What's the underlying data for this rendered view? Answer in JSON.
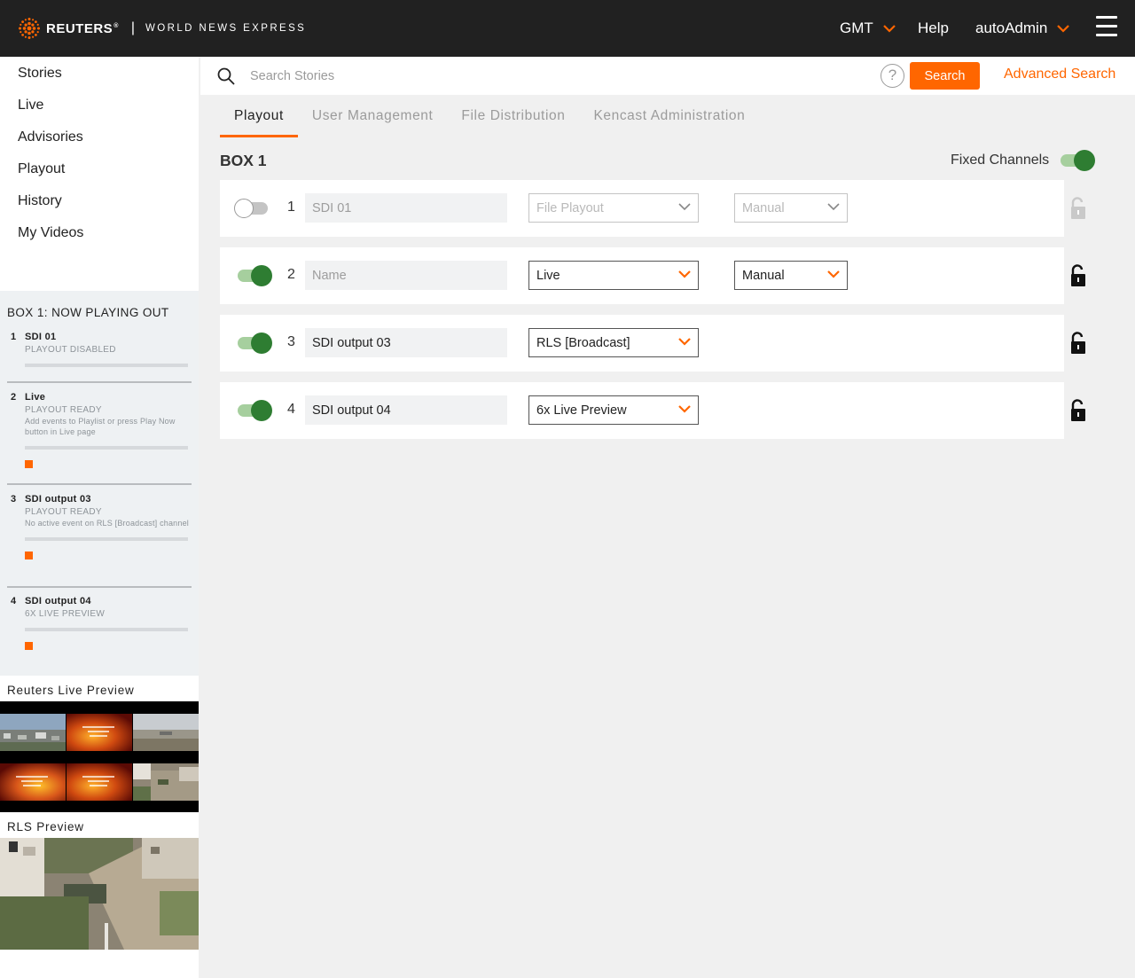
{
  "header": {
    "brand": "REUTERS",
    "brand_mark": "®",
    "separator": "|",
    "tagline": "WORLD NEWS EXPRESS",
    "timezone": "GMT",
    "help": "Help",
    "user": "autoAdmin",
    "accent_color": "#ff6600"
  },
  "nav": {
    "items": [
      {
        "label": "Stories"
      },
      {
        "label": "Live"
      },
      {
        "label": "Advisories"
      },
      {
        "label": "Playout"
      },
      {
        "label": "History"
      },
      {
        "label": "My Videos"
      }
    ]
  },
  "now_playing": {
    "title": "BOX 1: NOW PLAYING OUT",
    "channels": [
      {
        "num": "1",
        "name": "SDI 01",
        "status": "PLAYOUT DISABLED",
        "message": ""
      },
      {
        "num": "2",
        "name": "Live",
        "status": "PLAYOUT READY",
        "message": "Add events to Playlist or press Play Now button in Live page"
      },
      {
        "num": "3",
        "name": "SDI output 03",
        "status": "PLAYOUT READY",
        "message": "No active event on RLS [Broadcast] channel"
      },
      {
        "num": "4",
        "name": "SDI output 04",
        "status": "6X LIVE PREVIEW",
        "message": ""
      }
    ]
  },
  "previews": {
    "live_title": "Reuters Live Preview",
    "rls_title": "RLS Preview"
  },
  "search": {
    "placeholder": "Search Stories",
    "help_glyph": "?",
    "button": "Search",
    "advanced": "Advanced Search"
  },
  "tabs": [
    {
      "label": "Playout",
      "active": true
    },
    {
      "label": "User Management",
      "active": false
    },
    {
      "label": "File Distribution",
      "active": false
    },
    {
      "label": "Kencast Administration",
      "active": false
    }
  ],
  "box": {
    "title": "BOX 1",
    "fixed_channels_label": "Fixed Channels",
    "fixed_channels_on": true,
    "channels": [
      {
        "num": "1",
        "enabled": false,
        "name_value": "",
        "name_placeholder": "SDI 01",
        "source": "File Playout",
        "mode": "Manual",
        "locked": false
      },
      {
        "num": "2",
        "enabled": true,
        "name_value": "",
        "name_placeholder": "Name",
        "source": "Live",
        "mode": "Manual",
        "locked": false
      },
      {
        "num": "3",
        "enabled": true,
        "name_value": "SDI output 03",
        "name_placeholder": "",
        "source": "RLS [Broadcast]",
        "mode": "",
        "locked": false
      },
      {
        "num": "4",
        "enabled": true,
        "name_value": "SDI output 04",
        "name_placeholder": "",
        "source": "6x Live Preview",
        "mode": "",
        "locked": false
      }
    ]
  }
}
